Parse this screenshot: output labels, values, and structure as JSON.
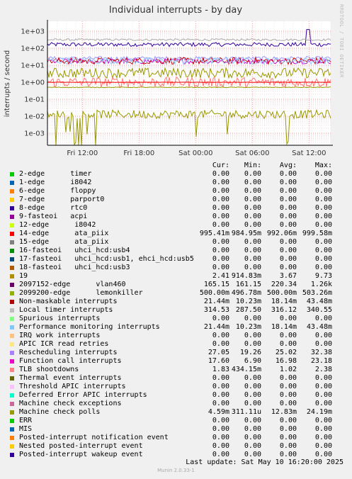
{
  "title": "Individual interrupts - by day",
  "side_label": "RRDTOOL / TOBI OETIKER",
  "chart_data": {
    "type": "line",
    "title": "Individual interrupts - by day",
    "ylabel": "interrupts / second",
    "yscale": "log",
    "ylim": [
      0.0003,
      2000
    ],
    "y_ticks": [
      "1e+03",
      "1e+02",
      "1e+01",
      "1e+00",
      "1e-01",
      "1e-02",
      "1e-03"
    ],
    "x_ticks": [
      "Fri 12:00",
      "Fri 18:00",
      "Sat 00:00",
      "Sat 06:00",
      "Sat 12:00"
    ],
    "x_tick_hours": [
      -26.3,
      -20.3,
      -14.3,
      -8.3,
      -2.3
    ],
    "xlim_hours": [
      -30,
      0
    ],
    "grid": true,
    "series": [
      {
        "name": "2097152-edge vlan460",
        "color": "#330099",
        "level": 165,
        "noise": 0.12
      },
      {
        "name": "Local timer interrupts",
        "color": "#aaaaaa",
        "level": 315,
        "noise": 0.06
      },
      {
        "name": "Rescheduling interrupts",
        "color": "#9999ff",
        "level": 25,
        "noise": 0.12
      },
      {
        "name": "Function call interrupts",
        "color": "#cc00cc",
        "level": 17,
        "noise": 0.15
      },
      {
        "name": "Non-maskable interrupts",
        "color": "#cc0000",
        "level": 18,
        "noise": 0.2
      },
      {
        "name": "Performance monitoring interrupts",
        "color": "#99ccff",
        "level": 18,
        "noise": 0.2
      },
      {
        "name": "Machine check polls",
        "color": "#999900",
        "level": 0.013,
        "noise": 0.25
      },
      {
        "name": "19",
        "color": "#999900",
        "level": 3.5,
        "noise": 0.3
      },
      {
        "name": "TLB shootdowns",
        "color": "#ff7777",
        "level": 1.0,
        "noise": 0.3
      },
      {
        "name": "14-edge ata_piix",
        "color": "#ff0000",
        "level": 0.99,
        "noise": 0.01
      },
      {
        "name": "2099200-edge lemonkiller",
        "color": "#999900",
        "level": 0.5,
        "noise": 0.02
      }
    ]
  },
  "legend_headers": {
    "cur": "Cur:",
    "min": "Min:",
    "avg": "Avg:",
    "max": "Max:"
  },
  "legend": [
    {
      "color": "#00cc00",
      "name": "2-edge      timer",
      "cur": "0.00",
      "min": "0.00",
      "avg": "0.00",
      "max": "0.00"
    },
    {
      "color": "#0066b3",
      "name": "1-edge      i8042",
      "cur": "0.00",
      "min": "0.00",
      "avg": "0.00",
      "max": "0.00"
    },
    {
      "color": "#ff8000",
      "name": "6-edge      floppy",
      "cur": "0.00",
      "min": "0.00",
      "avg": "0.00",
      "max": "0.00"
    },
    {
      "color": "#ffcc00",
      "name": "7-edge      parport0",
      "cur": "0.00",
      "min": "0.00",
      "avg": "0.00",
      "max": "0.00"
    },
    {
      "color": "#330099",
      "name": "8-edge      rtc0",
      "cur": "0.00",
      "min": "0.00",
      "avg": "0.00",
      "max": "0.00"
    },
    {
      "color": "#990099",
      "name": "9-fasteoi   acpi",
      "cur": "0.00",
      "min": "0.00",
      "avg": "0.00",
      "max": "0.00"
    },
    {
      "color": "#ccff00",
      "name": "12-edge      i8042",
      "cur": "0.00",
      "min": "0.00",
      "avg": "0.00",
      "max": "0.00"
    },
    {
      "color": "#ff0000",
      "name": "14-edge      ata_piix",
      "cur": "995.41m",
      "min": "984.95m",
      "avg": "992.06m",
      "max": "999.58m"
    },
    {
      "color": "#808080",
      "name": "15-edge      ata_piix",
      "cur": "0.00",
      "min": "0.00",
      "avg": "0.00",
      "max": "0.00"
    },
    {
      "color": "#008f00",
      "name": "16-fasteoi   uhci_hcd:usb4",
      "cur": "0.00",
      "min": "0.00",
      "avg": "0.00",
      "max": "0.00"
    },
    {
      "color": "#00487d",
      "name": "17-fasteoi   uhci_hcd:usb1, ehci_hcd:usb5",
      "cur": "0.00",
      "min": "0.00",
      "avg": "0.00",
      "max": "0.00"
    },
    {
      "color": "#b35a00",
      "name": "18-fasteoi   uhci_hcd:usb3",
      "cur": "0.00",
      "min": "0.00",
      "avg": "0.00",
      "max": "0.00"
    },
    {
      "color": "#b38f00",
      "name": "19",
      "cur": "2.41",
      "min": "914.83m",
      "avg": "3.67",
      "max": "9.73"
    },
    {
      "color": "#6b006b",
      "name": "2097152-edge      vlan460",
      "cur": "165.15",
      "min": "161.15",
      "avg": "220.34",
      "max": "1.26k"
    },
    {
      "color": "#8fb300",
      "name": "2099200-edge      lemonkiller",
      "cur": "500.00m",
      "min": "496.78m",
      "avg": "500.00m",
      "max": "503.26m"
    },
    {
      "color": "#b30000",
      "name": "Non-maskable interrupts",
      "cur": "21.44m",
      "min": "10.23m",
      "avg": "18.14m",
      "max": "43.48m"
    },
    {
      "color": "#bebebe",
      "name": "Local timer interrupts",
      "cur": "314.53",
      "min": "287.50",
      "avg": "316.12",
      "max": "340.55"
    },
    {
      "color": "#80ff80",
      "name": "Spurious interrupts",
      "cur": "0.00",
      "min": "0.00",
      "avg": "0.00",
      "max": "0.00"
    },
    {
      "color": "#80c9ff",
      "name": "Performance monitoring interrupts",
      "cur": "21.44m",
      "min": "10.23m",
      "avg": "18.14m",
      "max": "43.48m"
    },
    {
      "color": "#ffc080",
      "name": "IRQ work interrupts",
      "cur": "0.00",
      "min": "0.00",
      "avg": "0.00",
      "max": "0.00"
    },
    {
      "color": "#ffe680",
      "name": "APIC ICR read retries",
      "cur": "0.00",
      "min": "0.00",
      "avg": "0.00",
      "max": "0.00"
    },
    {
      "color": "#aa80ff",
      "name": "Rescheduling interrupts",
      "cur": "27.05",
      "min": "19.26",
      "avg": "25.02",
      "max": "32.38"
    },
    {
      "color": "#ee00cc",
      "name": "Function call interrupts",
      "cur": "17.60",
      "min": "6.90",
      "avg": "16.98",
      "max": "23.18"
    },
    {
      "color": "#ff8080",
      "name": "TLB shootdowns",
      "cur": "1.83",
      "min": "434.15m",
      "avg": "1.02",
      "max": "2.38"
    },
    {
      "color": "#666600",
      "name": "Thermal event interrupts",
      "cur": "0.00",
      "min": "0.00",
      "avg": "0.00",
      "max": "0.00"
    },
    {
      "color": "#ffbfff",
      "name": "Threshold APIC interrupts",
      "cur": "0.00",
      "min": "0.00",
      "avg": "0.00",
      "max": "0.00"
    },
    {
      "color": "#00ffcc",
      "name": "Deferred Error APIC interrupts",
      "cur": "0.00",
      "min": "0.00",
      "avg": "0.00",
      "max": "0.00"
    },
    {
      "color": "#cc6699",
      "name": "Machine check exceptions",
      "cur": "0.00",
      "min": "0.00",
      "avg": "0.00",
      "max": "0.00"
    },
    {
      "color": "#999900",
      "name": "Machine check polls",
      "cur": "4.59m",
      "min": "311.11u",
      "avg": "12.83m",
      "max": "24.19m"
    },
    {
      "color": "#00cc00",
      "name": "ERR",
      "cur": "0.00",
      "min": "0.00",
      "avg": "0.00",
      "max": "0.00"
    },
    {
      "color": "#0066b3",
      "name": "MIS",
      "cur": "0.00",
      "min": "0.00",
      "avg": "0.00",
      "max": "0.00"
    },
    {
      "color": "#ff8000",
      "name": "Posted-interrupt notification event",
      "cur": "0.00",
      "min": "0.00",
      "avg": "0.00",
      "max": "0.00"
    },
    {
      "color": "#ffcc00",
      "name": "Nested posted-interrupt event",
      "cur": "0.00",
      "min": "0.00",
      "avg": "0.00",
      "max": "0.00"
    },
    {
      "color": "#330099",
      "name": "Posted-interrupt wakeup event",
      "cur": "0.00",
      "min": "0.00",
      "avg": "0.00",
      "max": "0.00"
    }
  ],
  "last_update": "Last update:  Sat May 10 16:20:00 2025",
  "munin_version": "Munin 2.0.33-1"
}
